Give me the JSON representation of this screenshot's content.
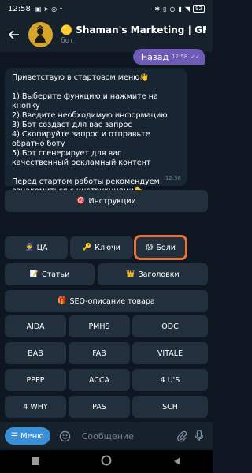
{
  "status_bar": {
    "time": "12:58",
    "battery": "92"
  },
  "header": {
    "title": "🟡 Shaman's Marketing | GF",
    "subtitle": "бот"
  },
  "outgoing_message": {
    "text": "Назад",
    "time": "12:58"
  },
  "incoming_message": {
    "text": "Приветствую в стартовом меню👋\n\n1) Выберите функцию и нажмите на кнопку\n2) Введите необходимую информацию\n3) Бот создаст для вас запрос\n4) Скопируйте запрос и отправьте обратно боту\n5) Бот сгенерирует для вас качественный рекламный контент\n\nПеред стартом работы рекомендуем ознакомиться с инструкциями👇",
    "time": "12:58"
  },
  "keyboard": {
    "instructions": {
      "emoji": "🎯",
      "label": "Инструкции"
    },
    "ca": {
      "emoji": "👮",
      "label": "ЦА"
    },
    "keys": {
      "emoji": "🔑",
      "label": "Ключи"
    },
    "pains": {
      "emoji": "😱",
      "label": "Боли"
    },
    "articles": {
      "emoji": "📝",
      "label": "Статьи"
    },
    "headlines": {
      "emoji": "👑",
      "label": "Заголовки"
    },
    "seo": {
      "emoji": "🎁",
      "label": "SEO-описание товара"
    },
    "aida": "AIDA",
    "pmhs": "PMHS",
    "odc": "ODC",
    "bab": "BAB",
    "fab": "FAB",
    "vitale": "VITALE",
    "pppp": "PPPP",
    "acca": "ACCA",
    "four_us": "4 U'S",
    "four_why": "4 WHY",
    "pas": "PAS",
    "sch": "SCH"
  },
  "input_bar": {
    "menu_label": "Меню",
    "placeholder": "Сообщение"
  },
  "colors": {
    "accent": "#3a8fd9",
    "outgoing_bubble": "#6d5bb5",
    "highlight": "#e8703a"
  }
}
